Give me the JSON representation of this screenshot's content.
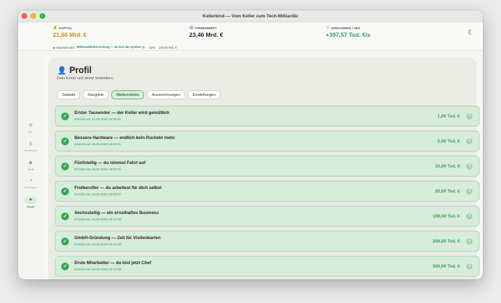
{
  "window": {
    "title": "Kellerkind — Vom Keller zum Tech-Milliardär"
  },
  "stats": [
    {
      "icon": "money-bag-icon",
      "glyph": "💰",
      "label": "KAPITAL",
      "value": "21,66 Mrd. €",
      "color": "#c98a12"
    },
    {
      "icon": "building-icon",
      "glyph": "🏢",
      "label": "FIRMENWERT",
      "value": "23,46 Mrd. €",
      "color": "#1f1f1f"
    },
    {
      "icon": "lightning-icon",
      "glyph": "⚡",
      "label": "EINNAHMEN / SEK",
      "value": "+397,57 Tsd. €/s",
      "color": "#2e9b53"
    }
  ],
  "goal": {
    "prefix": "Nächstes Ziel:",
    "name": "Weltmarktbeherrschung — du bist das System 👑",
    "progress": "23%",
    "target": "100,00 Mrd. €",
    "sep": "·"
  },
  "sidebar": {
    "items": [
      {
        "name": "sidebar-item-ikl",
        "icon": "gamepad-icon",
        "glyph": "✣",
        "label": "IKL",
        "active": false
      },
      {
        "name": "sidebar-item-verdienen",
        "icon": "dollar-icon",
        "glyph": "$",
        "label": "Verdienen",
        "active": false
      },
      {
        "name": "sidebar-item-skills",
        "icon": "graduation-cap-icon",
        "glyph": "◆",
        "label": "Skills",
        "active": false
      },
      {
        "name": "sidebar-item-vermoegen",
        "icon": "trend-chart-icon",
        "glyph": "↗",
        "label": "Vermögen",
        "active": false
      },
      {
        "name": "sidebar-item-profil",
        "icon": "person-icon",
        "glyph": "●",
        "label": "Profil",
        "active": true
      }
    ]
  },
  "page": {
    "title": "Profil",
    "subtitle": "Dein Konto und deine Statistiken."
  },
  "tabs": [
    {
      "label": "Statistik",
      "active": false
    },
    {
      "label": "Rangliste",
      "active": false
    },
    {
      "label": "Meilensteine",
      "active": true
    },
    {
      "label": "Auszeichnungen",
      "active": false
    },
    {
      "label": "Einstellungen",
      "active": false
    }
  ],
  "milestones": [
    {
      "title": "Erster Tausender — der Keller wird gemütlich",
      "date": "Erreicht am 15.06.2026 19:00:31",
      "amount": "1,00 Tsd. €"
    },
    {
      "title": "Bessere Hardware — endlich kein Ruckeln mehr",
      "date": "Erreicht am 15.06.2026 19:00:31",
      "amount": "5,00 Tsd. €"
    },
    {
      "title": "Fünfstellig — du nimmst Fahrt auf",
      "date": "Erreicht am 15.06.2026 19:00:31",
      "amount": "10,00 Tsd. €"
    },
    {
      "title": "Freiberufler — du arbeitest für dich selbst",
      "date": "Erreicht am 15.06.2026 20:05:07",
      "amount": "50,00 Tsd. €"
    },
    {
      "title": "Sechsstellig — ein ernsthaftes Business",
      "date": "Erreicht am 16.06.2026 19:12:46",
      "amount": "100,00 Tsd. €"
    },
    {
      "title": "GmbH-Gründung — Zeit für Visitenkarten",
      "date": "Erreicht am 16.06.2026 19:12:46",
      "amount": "250,00 Tsd. €"
    },
    {
      "title": "Erste Mitarbeiter — du bist jetzt Chef",
      "date": "Erreicht am 16.06.2026 19:12:46",
      "amount": "500,00 Tsd. €"
    }
  ]
}
